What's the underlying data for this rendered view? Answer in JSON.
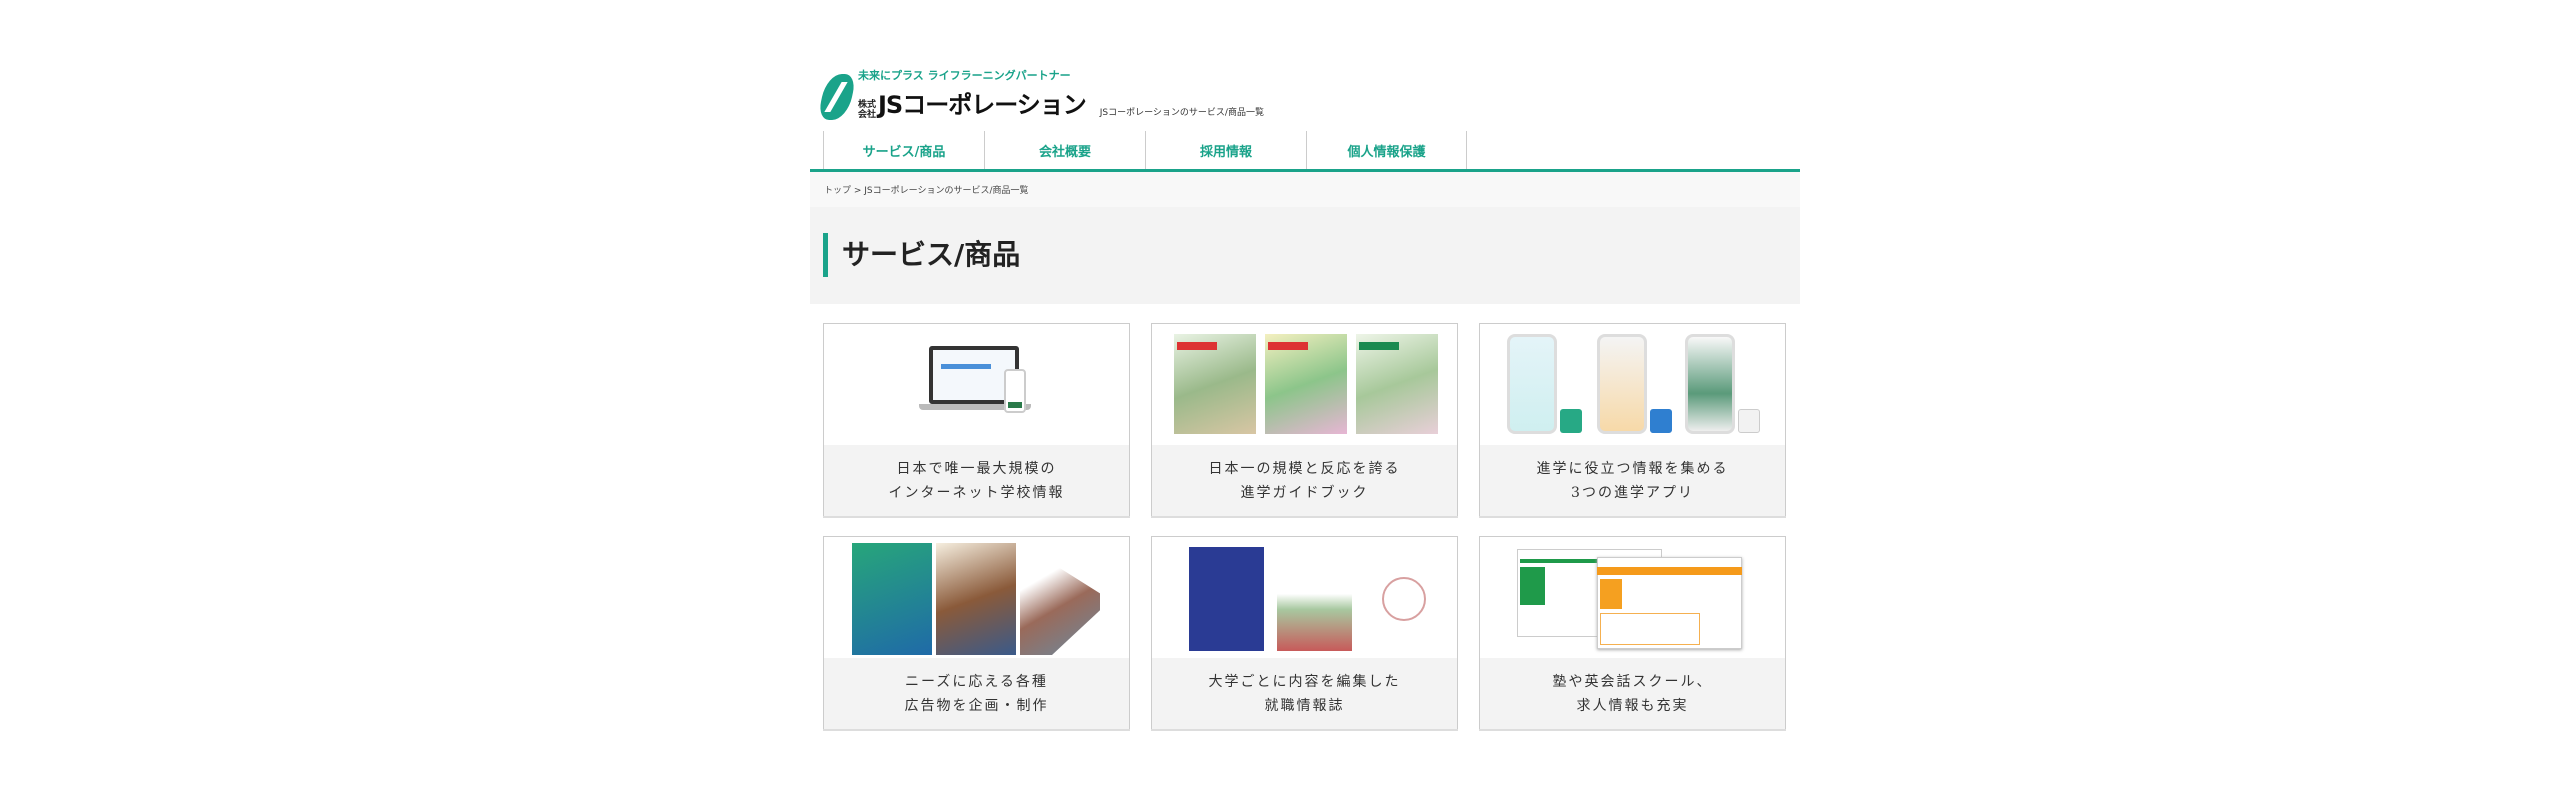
{
  "header": {
    "tagline": "未来にプラス ライフラーニングパートナー",
    "kabushiki": "株式会社",
    "company": "JSコーポレーション",
    "subtitle": "JSコーポレーションのサービス/商品一覧"
  },
  "nav": [
    {
      "label": "サービス/商品"
    },
    {
      "label": "会社概要"
    },
    {
      "label": "採用情報"
    },
    {
      "label": "個人情報保護"
    }
  ],
  "breadcrumb": {
    "home": "トップ",
    "separator": " > ",
    "current": "JSコーポレーションのサービス/商品一覧"
  },
  "page_title": "サービス/商品",
  "accent": "#1aa38a",
  "cards": [
    {
      "line1": "日本で唯一最大規模の",
      "line2": "インターネット学校情報"
    },
    {
      "line1": "日本一の規模と反応を誇る",
      "line2": "進学ガイドブック"
    },
    {
      "line1": "進学に役立つ情報を集める",
      "line2": "3つの進学アプリ"
    },
    {
      "line1": "ニーズに応える各種",
      "line2": "広告物を企画・制作"
    },
    {
      "line1": "大学ごとに内容を編集した",
      "line2": "就職情報誌"
    },
    {
      "line1": "塾や英会話スクール、",
      "line2": "求人情報も充実"
    }
  ]
}
